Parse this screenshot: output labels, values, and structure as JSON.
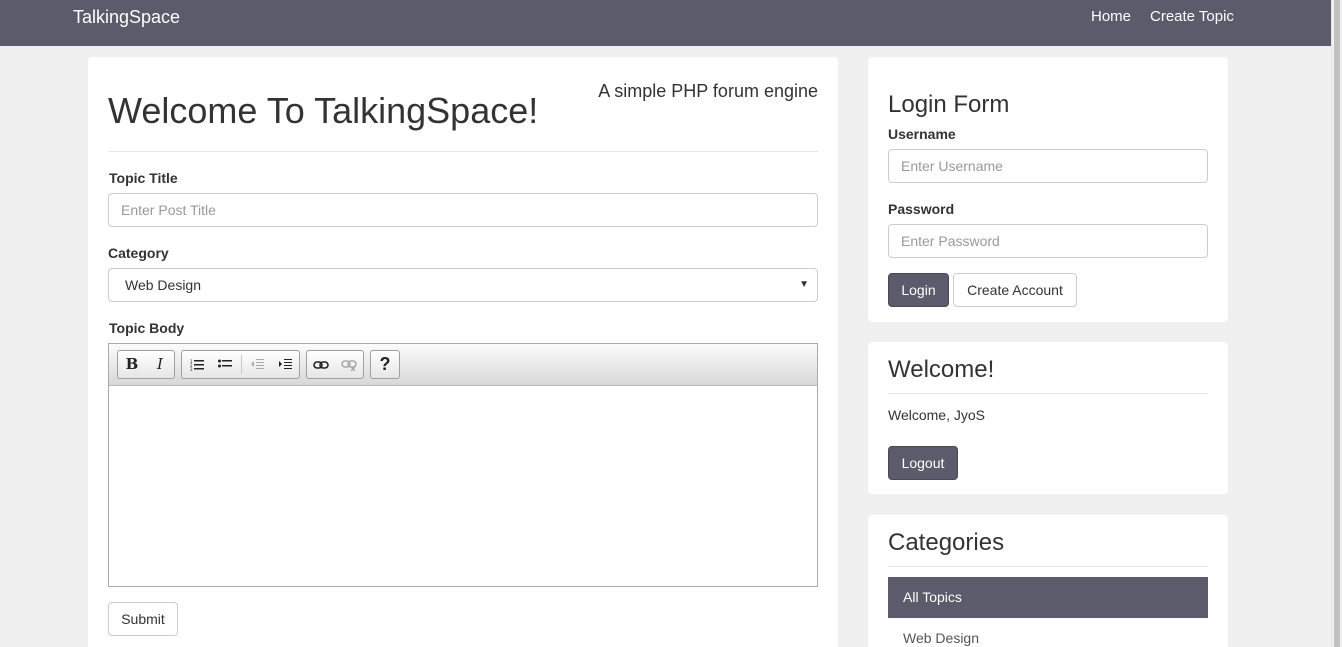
{
  "navbar": {
    "brand": "TalkingSpace",
    "links": [
      "Home",
      "Create Topic"
    ]
  },
  "main": {
    "tagline": "A simple PHP forum engine",
    "title": "Welcome To TalkingSpace!",
    "topic_title_label": "Topic Title",
    "topic_title_placeholder": "Enter Post Title",
    "category_label": "Category",
    "category_selected": "Web Design",
    "topic_body_label": "Topic Body",
    "editor_toolbar": {
      "bold": "B",
      "italic": "I",
      "help": "?"
    },
    "submit_label": "Submit"
  },
  "login_form": {
    "title": "Login Form",
    "username_label": "Username",
    "username_placeholder": "Enter Username",
    "password_label": "Password",
    "password_placeholder": "Enter Password",
    "login_label": "Login",
    "create_account_label": "Create Account"
  },
  "welcome": {
    "title": "Welcome!",
    "text": "Welcome, JyoS",
    "logout_label": "Logout"
  },
  "categories": {
    "title": "Categories",
    "items": [
      "All Topics",
      "Web Design"
    ]
  },
  "colors": {
    "accent": "#5b5b6b",
    "background": "#f0f0f0"
  }
}
